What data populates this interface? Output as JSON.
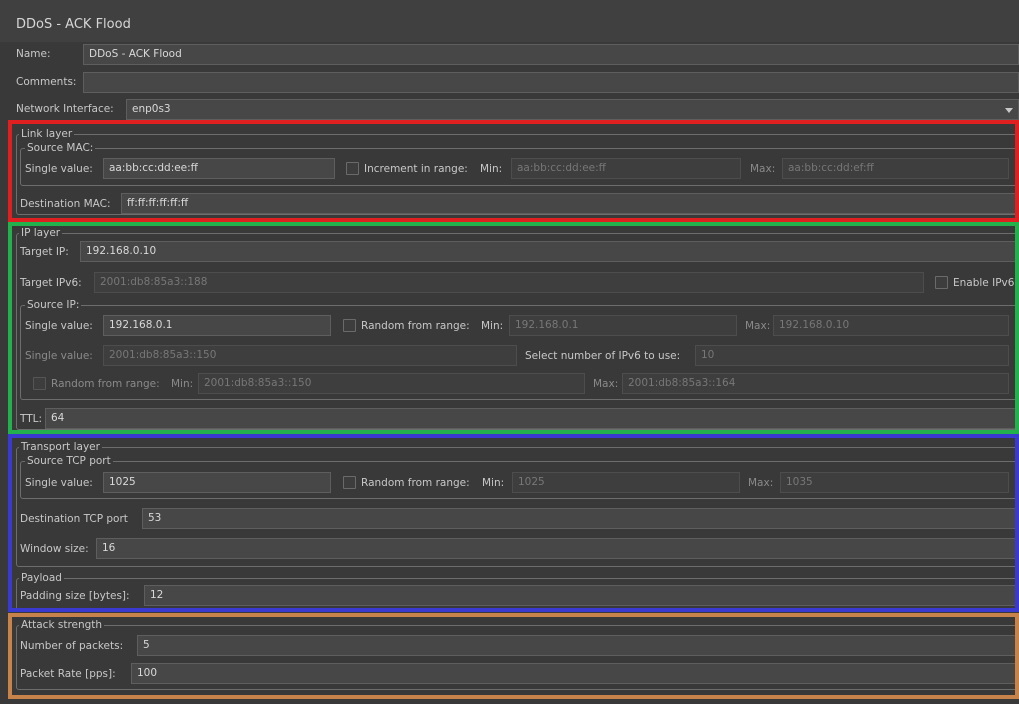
{
  "title": "DDoS - ACK Flood",
  "name": {
    "label": "Name:",
    "value": "DDoS - ACK Flood"
  },
  "comments": {
    "label": "Comments:",
    "value": ""
  },
  "network_interface": {
    "label": "Network Interface:",
    "value": "enp0s3"
  },
  "link_layer": {
    "legend": "Link layer",
    "source_mac": {
      "legend": "Source MAC:",
      "single_label": "Single value:",
      "single_value": "aa:bb:cc:dd:ee:ff",
      "increment_label": "Increment in range:",
      "increment_checked": false,
      "min_label": "Min:",
      "min_value": "aa:bb:cc:dd:ee:ff",
      "max_label": "Max:",
      "max_value": "aa:bb:cc:dd:ef:ff"
    },
    "dest_mac": {
      "label": "Destination MAC:",
      "value": "ff:ff:ff:ff:ff:ff"
    }
  },
  "ip_layer": {
    "legend": "IP layer",
    "target_ip": {
      "label": "Target IP:",
      "value": "192.168.0.10"
    },
    "target_ipv6": {
      "label": "Target IPv6:",
      "value": "2001:db8:85a3::188"
    },
    "enable_ipv6": {
      "label": "Enable IPv6",
      "checked": false
    },
    "source_ip": {
      "legend": "Source IP:",
      "single_label": "Single value:",
      "single_value": "192.168.0.1",
      "random_label": "Random from range:",
      "random_checked": false,
      "min_label": "Min:",
      "min_value": "192.168.0.1",
      "max_label": "Max:",
      "max_value": "192.168.0.10",
      "single6_label": "Single value:",
      "single6_value": "2001:db8:85a3::150",
      "select6_label": "Select number of IPv6 to use:",
      "select6_value": "10",
      "random6_label": "Random from range:",
      "random6_checked": false,
      "min6_label": "Min:",
      "min6_value": "2001:db8:85a3::150",
      "max6_label": "Max:",
      "max6_value": "2001:db8:85a3::164"
    },
    "ttl": {
      "label": "TTL:",
      "value": "64"
    }
  },
  "transport_layer": {
    "legend": "Transport layer",
    "source_tcp": {
      "legend": "Source TCP port",
      "single_label": "Single value:",
      "single_value": "1025",
      "random_label": "Random from range:",
      "random_checked": false,
      "min_label": "Min:",
      "min_value": "1025",
      "max_label": "Max:",
      "max_value": "1035"
    },
    "dest_tcp": {
      "label": "Destination TCP port",
      "value": "53"
    },
    "window_size": {
      "label": "Window size:",
      "value": "16"
    }
  },
  "payload": {
    "legend": "Payload",
    "padding": {
      "label": "Padding size [bytes]:",
      "value": "12"
    }
  },
  "attack_strength": {
    "legend": "Attack strength",
    "packets": {
      "label": "Number of packets:",
      "value": "5"
    },
    "rate": {
      "label": "Packet Rate [pps]:",
      "value": "100"
    }
  },
  "highlight_colors": {
    "link_layer": "#e02020",
    "ip_layer": "#22b14c",
    "transport_layer": "#3a3ad0",
    "attack_strength": "#c8834a"
  }
}
